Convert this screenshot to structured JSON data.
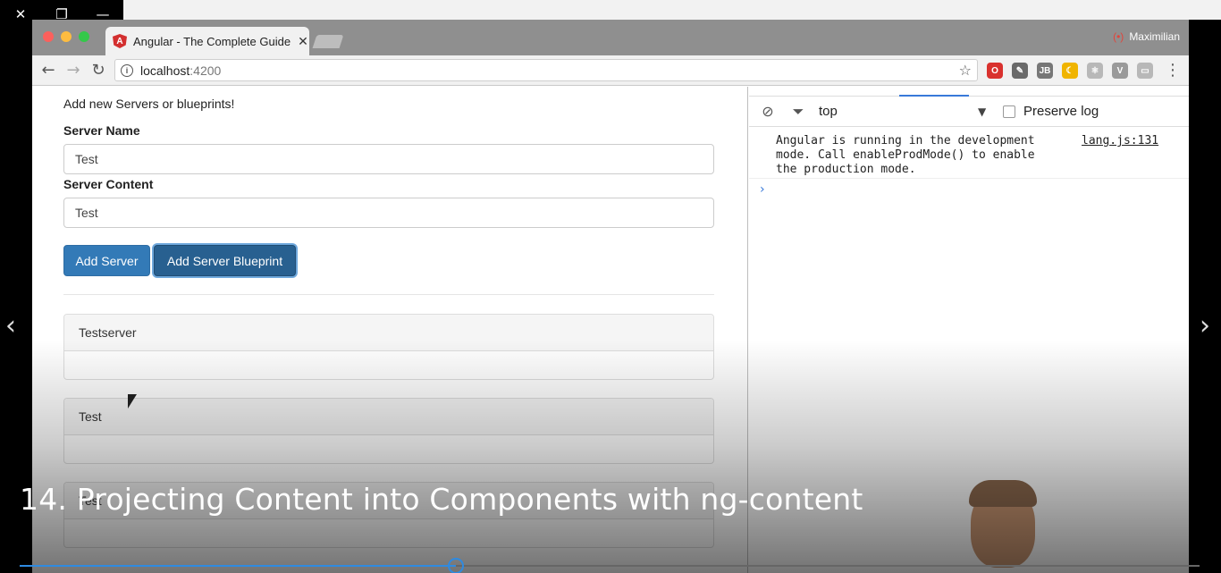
{
  "player": {
    "close_glyph": "✕",
    "restore_glyph": "❐",
    "minimize_glyph": "—",
    "prev_glyph": "‹",
    "next_glyph": "›",
    "caption": "14. Projecting Content into Components with ng-content",
    "progress_fraction": 0.37,
    "accent": "#2f8ae0"
  },
  "browser": {
    "tab_title": "Angular - The Complete Guide",
    "tab_logo_letter": "A",
    "tab_close": "✕",
    "profile_name": "Maximilian",
    "profile_icon": "(•)",
    "address": {
      "host": "localhost",
      "port": ":4200"
    },
    "info_icon": "i",
    "star_icon": "☆",
    "back_glyph": "←",
    "forward_glyph": "→",
    "reload_glyph": "↻",
    "menu_glyph": "⋮",
    "extensions": [
      {
        "name": "opera-icon",
        "label": "O",
        "color": "#d9312e"
      },
      {
        "name": "eyedropper-icon",
        "label": "✎",
        "color": "#6a6a6a"
      },
      {
        "name": "jb-icon",
        "label": "JB",
        "color": "#777777"
      },
      {
        "name": "moon-icon",
        "label": "☾",
        "color": "#f0b400"
      },
      {
        "name": "react-icon",
        "label": "⚛",
        "color": "#b8b8b8"
      },
      {
        "name": "vue-icon",
        "label": "V",
        "color": "#9a9a9a"
      },
      {
        "name": "cast-icon",
        "label": "▭",
        "color": "#b8b8b8"
      }
    ]
  },
  "app": {
    "intro": "Add new Servers or blueprints!",
    "server_name_label": "Server Name",
    "server_name_value": "Test",
    "server_content_label": "Server Content",
    "server_content_value": "Test",
    "add_server_label": "Add Server",
    "add_blueprint_label": "Add Server Blueprint",
    "panels": [
      {
        "title": "Testserver"
      },
      {
        "title": "Test"
      },
      {
        "title": "Test"
      }
    ]
  },
  "devtools": {
    "context": "top",
    "dropdown_glyph": "▼",
    "preserve_log_label": "Preserve log",
    "message": "Angular is running in the development mode. Call enableProdMode() to enable the production mode.",
    "message_source": "lang.js:131",
    "prompt_glyph": "›",
    "block_icon": "⊘",
    "filter_icon": "⏷"
  }
}
